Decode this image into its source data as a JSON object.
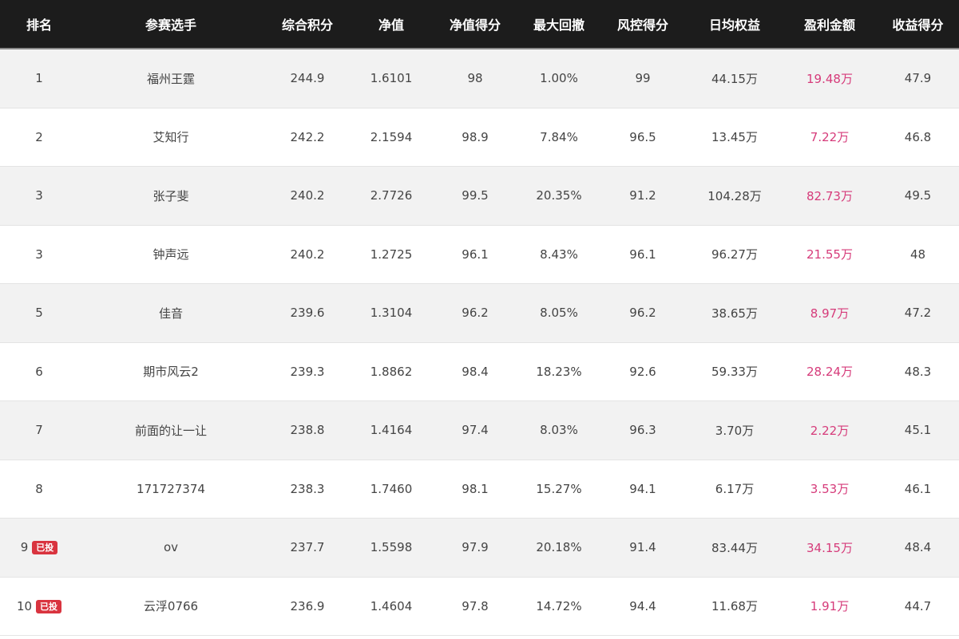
{
  "columns": [
    "排名",
    "参赛选手",
    "综合积分",
    "净值",
    "净值得分",
    "最大回撤",
    "风控得分",
    "日均权益",
    "盈利金额",
    "收益得分"
  ],
  "badge_label": "已投",
  "rows": [
    {
      "rank": "1",
      "name": "福州王霆",
      "score": "244.9",
      "nav": "1.6101",
      "nav_score": "98",
      "max_dd": "1.00%",
      "risk_score": "99",
      "avg_equity": "44.15万",
      "profit": "19.48万",
      "return_score": "47.9",
      "badge": false
    },
    {
      "rank": "2",
      "name": "艾知行",
      "score": "242.2",
      "nav": "2.1594",
      "nav_score": "98.9",
      "max_dd": "7.84%",
      "risk_score": "96.5",
      "avg_equity": "13.45万",
      "profit": "7.22万",
      "return_score": "46.8",
      "badge": false
    },
    {
      "rank": "3",
      "name": "张子斐",
      "score": "240.2",
      "nav": "2.7726",
      "nav_score": "99.5",
      "max_dd": "20.35%",
      "risk_score": "91.2",
      "avg_equity": "104.28万",
      "profit": "82.73万",
      "return_score": "49.5",
      "badge": false
    },
    {
      "rank": "3",
      "name": "钟声远",
      "score": "240.2",
      "nav": "1.2725",
      "nav_score": "96.1",
      "max_dd": "8.43%",
      "risk_score": "96.1",
      "avg_equity": "96.27万",
      "profit": "21.55万",
      "return_score": "48",
      "badge": false
    },
    {
      "rank": "5",
      "name": "佳音",
      "score": "239.6",
      "nav": "1.3104",
      "nav_score": "96.2",
      "max_dd": "8.05%",
      "risk_score": "96.2",
      "avg_equity": "38.65万",
      "profit": "8.97万",
      "return_score": "47.2",
      "badge": false
    },
    {
      "rank": "6",
      "name": "期市风云2",
      "score": "239.3",
      "nav": "1.8862",
      "nav_score": "98.4",
      "max_dd": "18.23%",
      "risk_score": "92.6",
      "avg_equity": "59.33万",
      "profit": "28.24万",
      "return_score": "48.3",
      "badge": false
    },
    {
      "rank": "7",
      "name": "前面的让一让",
      "score": "238.8",
      "nav": "1.4164",
      "nav_score": "97.4",
      "max_dd": "8.03%",
      "risk_score": "96.3",
      "avg_equity": "3.70万",
      "profit": "2.22万",
      "return_score": "45.1",
      "badge": false
    },
    {
      "rank": "8",
      "name": "171727374",
      "score": "238.3",
      "nav": "1.7460",
      "nav_score": "98.1",
      "max_dd": "15.27%",
      "risk_score": "94.1",
      "avg_equity": "6.17万",
      "profit": "3.53万",
      "return_score": "46.1",
      "badge": false
    },
    {
      "rank": "9",
      "name": "ov",
      "score": "237.7",
      "nav": "1.5598",
      "nav_score": "97.9",
      "max_dd": "20.18%",
      "risk_score": "91.4",
      "avg_equity": "83.44万",
      "profit": "34.15万",
      "return_score": "48.4",
      "badge": true
    },
    {
      "rank": "10",
      "name": "云浮0766",
      "score": "236.9",
      "nav": "1.4604",
      "nav_score": "97.8",
      "max_dd": "14.72%",
      "risk_score": "94.4",
      "avg_equity": "11.68万",
      "profit": "1.91万",
      "return_score": "44.7",
      "badge": true
    }
  ],
  "colors": {
    "header_bg": "#1c1c1c",
    "row_alt_bg": "#f2f2f2",
    "profit_text": "#d63b7a",
    "badge_bg": "#d9343f"
  }
}
